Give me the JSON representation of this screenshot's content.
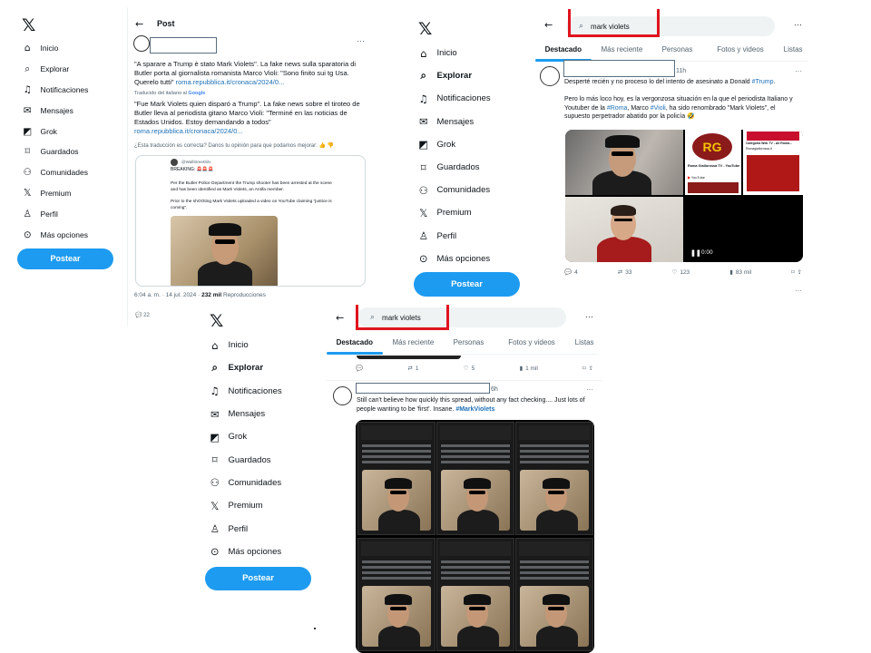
{
  "nav": {
    "logo": "𝕏",
    "items": [
      {
        "label": "Inicio",
        "icon": "home-icon"
      },
      {
        "label": "Explorar",
        "icon": "search-icon"
      },
      {
        "label": "Notificaciones",
        "icon": "bell-icon"
      },
      {
        "label": "Mensajes",
        "icon": "mail-icon"
      },
      {
        "label": "Grok",
        "icon": "grok-icon"
      },
      {
        "label": "Guardados",
        "icon": "bookmark-icon"
      },
      {
        "label": "Comunidades",
        "icon": "communities-icon"
      },
      {
        "label": "Premium",
        "icon": "x-premium-icon"
      },
      {
        "label": "Perfil",
        "icon": "person-icon"
      },
      {
        "label": "Más opciones",
        "icon": "more-circle-icon"
      }
    ],
    "post_button": "Postear"
  },
  "panel1": {
    "header_title": "Post",
    "original_text": "\"A sparare a Trump è stato Mark Violets\". La fake news sulla sparatoria di Butler porta al giornalista romanista Marco Violi: \"Sono finito sui tg Usa. Querelo tutti\"",
    "original_link": "roma.repubblica.it/cronaca/2024/0...",
    "translated_from": "Traducido del italiano al",
    "translated_by": "Google",
    "translated_text": "\"Fue Mark Violets quien disparó a Trump\". La fake news sobre el tiroteo de Butler lleva al periodista gitano Marco Violi: \"Terminé en las noticias de Estados Unidos. Estoy demandando a todos\"",
    "translated_link": "roma.repubblica.it/cronaca/2024/0...",
    "feedback": "¿Esta traducción es correcta? Danos tu opinión para que podamos mejorar:",
    "embed_handle": "@WallStreetSilv",
    "embed_breaking": "BREAKING: 🚨🚨🚨",
    "embed_line1": "Per the Butler Police Department the Trump shooter has been arrested at the scene and has been identified as Mark Violets, an Antifa member.",
    "embed_line2": "Prior to the shOOting Mark Violets uploaded a video on YouTube claiming \"justice is coming\".",
    "timestamp": "6:04 a. m. · 14 jul. 2024 ·",
    "views": "232 mil",
    "views_label": "Reproducciones",
    "reply_count": "22"
  },
  "panel2": {
    "search_value": "mark violets",
    "tabs": [
      "Destacado",
      "Más reciente",
      "Personas",
      "Fotos y videos",
      "Listas"
    ],
    "time": "11h",
    "text_a": "Desperté recién y no proceso lo del intento de asesinato a Donald",
    "hashtag_a": "#Trump",
    "text_b": "Pero lo más loco hoy, es la vergonzosa situación en la que el periodista Italiano y Youtuber de la",
    "hashtag_b1": "#Roma",
    "text_c": ", Marco",
    "hashtag_b2": "#Violi",
    "text_d": ", ha sido renombrado \"Mark Violets\", el supuesto perpetrador abatido por la policía 🤣",
    "video_time": "0:00",
    "channel_title": "Roma Giallorossa TV - YouTube",
    "channel_sub": "YouTube",
    "web_title": "Categoria Web TV - All Roma...",
    "web_sub": "Romagiallorossa.it",
    "replies": "4",
    "reposts": "33",
    "likes": "123",
    "views": "83 mil"
  },
  "panel3": {
    "search_value": "mark violets",
    "tabs": [
      "Destacado",
      "Más reciente",
      "Personas",
      "Fotos y videos",
      "Listas"
    ],
    "top_reposts": "1",
    "top_likes": "5",
    "top_views": "1 mil",
    "time": "6h",
    "text": "Still can't believe how quickly this spread, without any fact checking.... Just lots of people wanting to be 'first'. Insane.",
    "hashtag": "#MarkViolets"
  },
  "colors": {
    "accent": "#1d9bf0",
    "highlight": "#e0141e",
    "link": "#1d70b8"
  }
}
